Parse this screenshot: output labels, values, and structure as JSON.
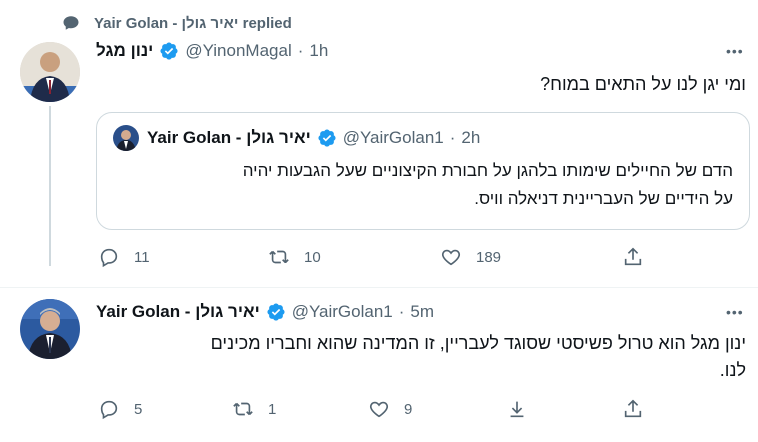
{
  "context": {
    "icon": "speech-bubble-icon",
    "text": "Yair Golan - יאיר גולן replied"
  },
  "tweet1": {
    "display_name": "ינון מגל",
    "handle": "@YinonMagal",
    "separator": "·",
    "time": "1h",
    "text": "ומי יגן לנו על התאים במוח?",
    "more_label": "•••",
    "quote": {
      "display_name": "Yair Golan - יאיר גולן",
      "handle": "@YairGolan1",
      "separator": "·",
      "time": "2h",
      "text_line1": "הדם של החיילים שימותו בלהגן על חבורת הקיצוניים שעל הגבעות יהיה",
      "text_line2": "על הידיים של העבריינית דניאלה וויס."
    },
    "actions": {
      "reply": "11",
      "retweet": "10",
      "like": "189"
    }
  },
  "tweet2": {
    "display_name": "Yair Golan - יאיר גולן",
    "handle": "@YairGolan1",
    "separator": "·",
    "time": "5m",
    "text_line1": "ינון מגל הוא טרול פשיסטי שסוגד לעבריין, זו המדינה שהוא וחבריו מכינים",
    "text_line2": "לנו.",
    "more_label": "•••",
    "actions": {
      "reply": "5",
      "retweet": "1",
      "like": "9"
    }
  },
  "colors": {
    "verified": "#1d9bf0",
    "muted": "#536471",
    "border": "#cfd9de"
  }
}
